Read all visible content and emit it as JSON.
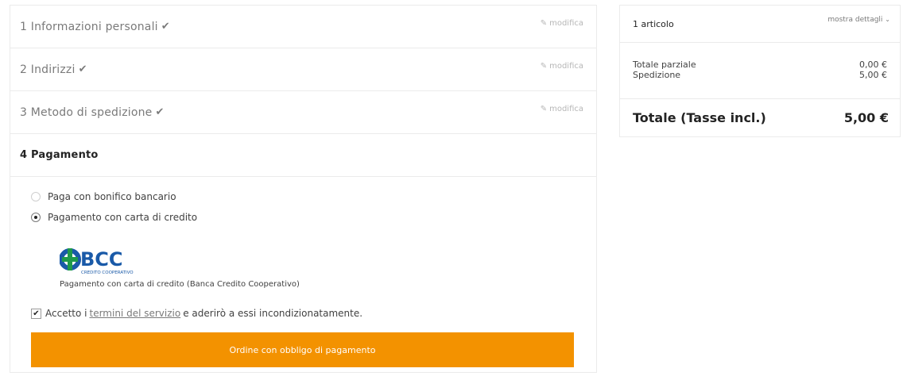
{
  "steps": [
    {
      "label": "1 Informazioni personali",
      "edit": "modifica"
    },
    {
      "label": "2 Indirizzi",
      "edit": "modifica"
    },
    {
      "label": "3 Metodo di spedizione",
      "edit": "modifica"
    }
  ],
  "payment": {
    "title": "4 Pagamento",
    "options": [
      {
        "label": "Paga con bonifico bancario",
        "selected": false
      },
      {
        "label": "Pagamento con carta di credito",
        "selected": true
      }
    ],
    "bank_logo_text": "BCC",
    "bank_logo_subtext": "CREDITO COOPERATIVO",
    "bank_caption": "Pagamento con carta di credito (Banca Credito Cooperativo)",
    "terms_prefix": "Accetto i",
    "terms_link": "termini del servizio",
    "terms_suffix": "e aderirò a essi incondizionatamente.",
    "terms_checked": true,
    "order_button": "Ordine con obbligo di pagamento"
  },
  "summary": {
    "count": "1 articolo",
    "details_toggle": "mostra dettagli",
    "subtotal_label": "Totale parziale",
    "subtotal_value": "0,00 €",
    "shipping_label": "Spedizione",
    "shipping_value": "5,00 €",
    "total_label": "Totale (Tasse incl.)",
    "total_value": "5,00 €"
  },
  "colors": {
    "accent": "#f39200",
    "logo_blue": "#1a5aa8",
    "logo_green": "#1f9a4a"
  },
  "icons": {
    "check": "check-icon",
    "pencil": "pencil-icon",
    "chevron": "chevron-down-icon"
  }
}
